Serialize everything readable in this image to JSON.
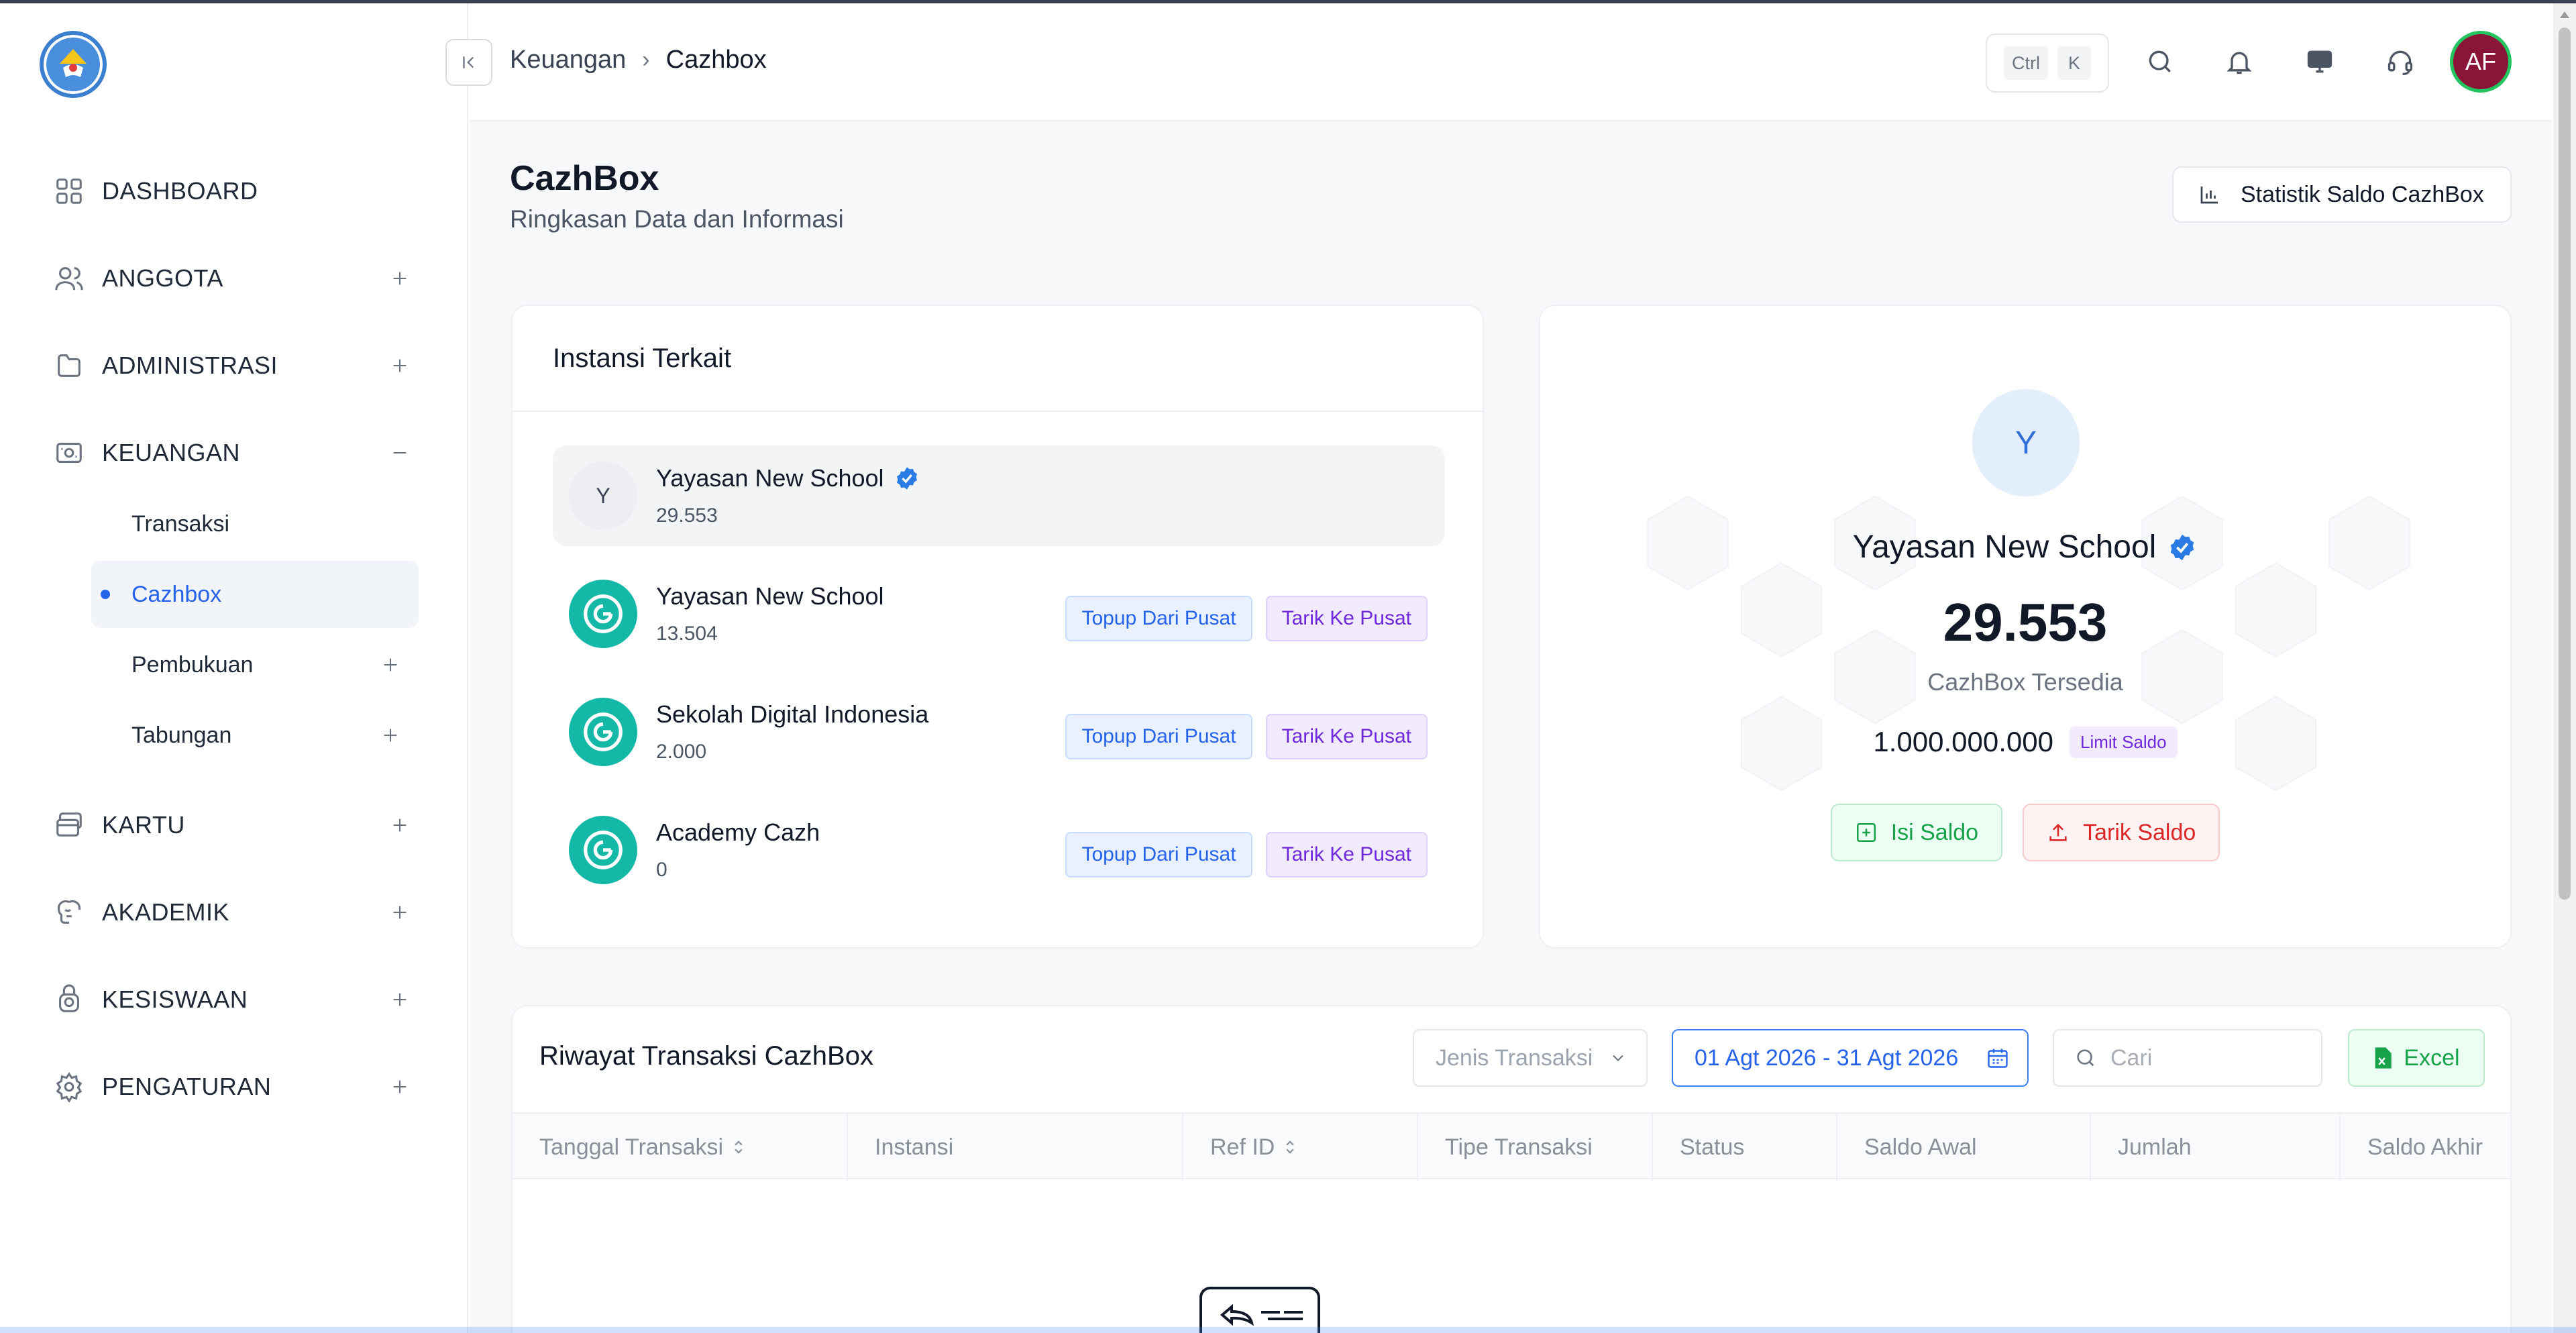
{
  "topbar": {
    "breadcrumb": [
      "Keuangan",
      "Cazhbox"
    ],
    "kbd": [
      "Ctrl",
      "K"
    ],
    "user_initials": "AF",
    "icons": [
      "search-icon",
      "bell-icon",
      "monitor-icon",
      "headset-icon"
    ]
  },
  "sidebar": {
    "items": [
      {
        "label": "DASHBOARD",
        "icon": "grid-icon",
        "expandable": false
      },
      {
        "label": "ANGGOTA",
        "icon": "users-icon",
        "expandable": true
      },
      {
        "label": "ADMINISTRASI",
        "icon": "folder-icon",
        "expandable": true
      },
      {
        "label": "KEUANGAN",
        "icon": "wallet-icon",
        "expandable": true,
        "expanded": true
      },
      {
        "label": "KARTU",
        "icon": "cards-icon",
        "expandable": true
      },
      {
        "label": "AKADEMIK",
        "icon": "brain-icon",
        "expandable": true
      },
      {
        "label": "KESISWAAN",
        "icon": "student-icon",
        "expandable": true
      },
      {
        "label": "PENGATURAN",
        "icon": "gear-icon",
        "expandable": true
      }
    ],
    "keuangan_sub": [
      {
        "label": "Transaksi"
      },
      {
        "label": "Cazhbox",
        "active": true
      },
      {
        "label": "Pembukuan",
        "expandable": true
      },
      {
        "label": "Tabungan",
        "expandable": true
      }
    ]
  },
  "page": {
    "title": "CazhBox",
    "subtitle": "Ringkasan Data dan Informasi",
    "stat_button": "Statistik Saldo CazhBox"
  },
  "instansi": {
    "header": "Instansi Terkait",
    "items": [
      {
        "initial": "Y",
        "name": "Yayasan New School",
        "value": "29.553",
        "verified": true,
        "selected": true
      },
      {
        "name": "Yayasan New School",
        "value": "13.504",
        "topup": "Topup Dari Pusat",
        "tarik": "Tarik Ke Pusat"
      },
      {
        "name": "Sekolah Digital Indonesia",
        "value": "2.000",
        "topup": "Topup Dari Pusat",
        "tarik": "Tarik Ke Pusat"
      },
      {
        "name": "Academy Cazh",
        "value": "0",
        "topup": "Topup Dari Pusat",
        "tarik": "Tarik Ke Pusat"
      }
    ]
  },
  "summary": {
    "initial": "Y",
    "name": "Yayasan New School",
    "amount": "29.553",
    "amount_label": "CazhBox Tersedia",
    "limit": "1.000.000.000",
    "limit_badge": "Limit Saldo",
    "isi_label": "Isi Saldo",
    "tarik_label": "Tarik Saldo"
  },
  "riwayat": {
    "title": "Riwayat Transaksi CazhBox",
    "jenis_placeholder": "Jenis Transaksi",
    "date_range": "01 Agt 2026 - 31 Agt 2026",
    "search_placeholder": "Cari",
    "excel_label": "Excel",
    "columns": [
      "Tanggal Transaksi",
      "Instansi",
      "Ref ID",
      "Tipe Transaksi",
      "Status",
      "Saldo Awal",
      "Jumlah",
      "Saldo Akhir"
    ]
  },
  "colors": {
    "accent": "#2563eb",
    "teal": "#14b8a6",
    "green": "#16a34a",
    "red": "#dc2626",
    "purple": "#6d28d9",
    "avatar_bg": "#8b1538"
  }
}
